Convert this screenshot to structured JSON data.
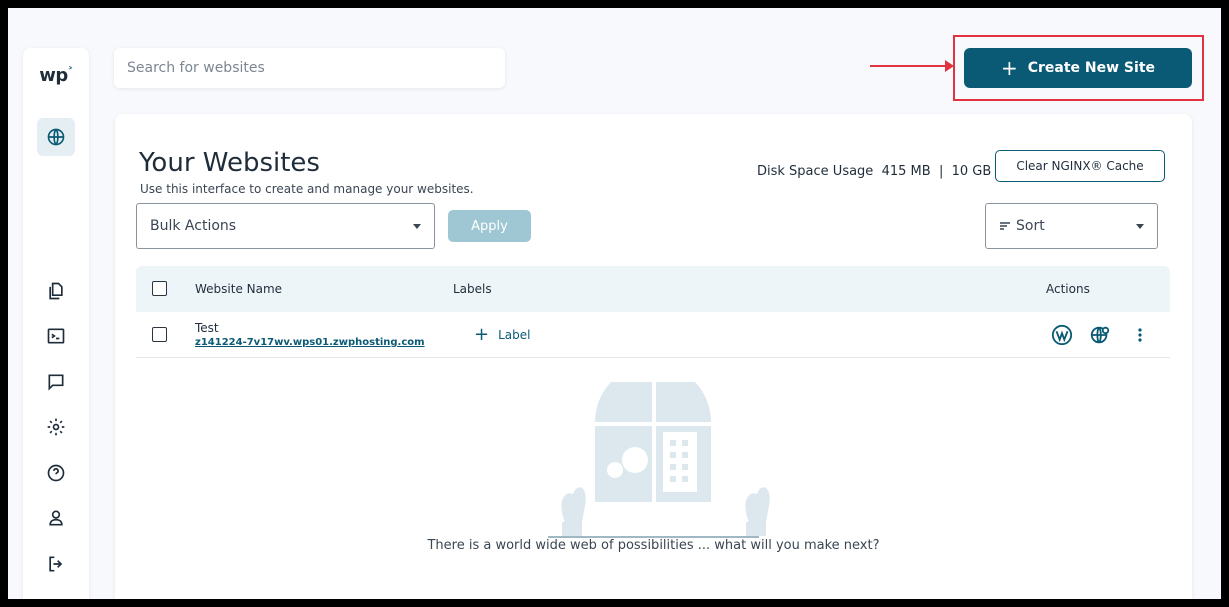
{
  "brand": {
    "logo_text": "wp",
    "logo_mark": "˃",
    "accent": "#0b5a75",
    "highlight_color": "#e0333f"
  },
  "sidebar": {
    "items": [
      {
        "name": "websites",
        "icon": "globe-icon",
        "active": true
      },
      {
        "name": "files",
        "icon": "files-icon"
      },
      {
        "name": "terminal",
        "icon": "terminal-icon"
      },
      {
        "name": "messages",
        "icon": "chat-icon"
      },
      {
        "name": "settings",
        "icon": "gear-icon"
      },
      {
        "name": "help",
        "icon": "help-icon"
      },
      {
        "name": "account",
        "icon": "user-icon"
      },
      {
        "name": "logout",
        "icon": "logout-icon"
      }
    ]
  },
  "search": {
    "placeholder": "Search for websites",
    "value": ""
  },
  "header": {
    "create_label": "Create New Site"
  },
  "main": {
    "title": "Your Websites",
    "subtitle": "Use this interface to create and manage your websites.",
    "disk_label": "Disk Space Usage",
    "disk_used": "415 MB",
    "disk_separator": "|",
    "disk_total": "10 GB",
    "clear_cache_label": "Clear NGINX® Cache",
    "bulk_actions_label": "Bulk Actions",
    "apply_label": "Apply",
    "sort_label": "Sort"
  },
  "table": {
    "columns": [
      "Website Name",
      "Labels",
      "Actions"
    ],
    "rows": [
      {
        "name": "Test",
        "url": "z141224-7v17wv.wps01.zwphosting.com",
        "add_label": "Label",
        "actions": [
          "wordpress-icon",
          "globe-settings-icon",
          "more-vertical-icon"
        ]
      }
    ]
  },
  "empty_state": {
    "message": "There is a world wide web of possibilities ... what will you make next?"
  }
}
